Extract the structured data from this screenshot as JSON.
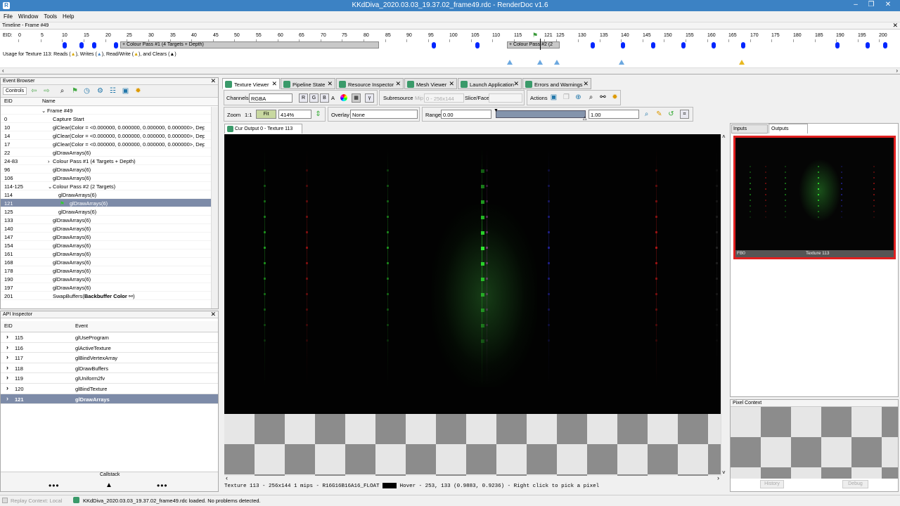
{
  "window": {
    "title": "KKdDiva_2020.03.03_19.37.02_frame49.rdc - RenderDoc v1.6",
    "app_icon": "renderdoc-icon"
  },
  "menu": [
    "File",
    "Window",
    "Tools",
    "Help"
  ],
  "timeline": {
    "title": "Timeline - Frame #49",
    "eid_label": "EID:",
    "ticks": [
      "0",
      "5",
      "10",
      "15",
      "20",
      "25",
      "30",
      "35",
      "40",
      "45",
      "50",
      "55",
      "60",
      "65",
      "70",
      "75",
      "80",
      "85",
      "90",
      "95",
      "100",
      "105",
      "110",
      "115",
      "121",
      "125",
      "130",
      "135",
      "140",
      "145",
      "150",
      "155",
      "160",
      "165",
      "170",
      "175",
      "180",
      "185",
      "190",
      "195",
      "200"
    ],
    "pass1": "+ Colour Pass #1 (4 Targets + Depth)",
    "pass2": "+ Colour Pass #2 (2",
    "usage": "Usage for Texture 113: Reads (",
    "usage_writes": "), Writes (",
    "usage_rw": "), Read/Write (",
    "usage_clears": "), and Clears (",
    "usage_end": ")"
  },
  "event_browser": {
    "title": "Event Browser",
    "controls_label": "Controls",
    "col_eid": "EID",
    "col_name": "Name",
    "rows": [
      {
        "eid": "",
        "name": "Frame #49"
      },
      {
        "eid": "0",
        "name": "Capture Start"
      },
      {
        "eid": "10",
        "name": "glClear(Color = <0.000000, 0.000000, 0.000000, 0.000000>, Dep..."
      },
      {
        "eid": "14",
        "name": "glClear(Color = <0.000000, 0.000000, 0.000000, 0.000000>, Dep..."
      },
      {
        "eid": "17",
        "name": "glClear(Color = <0.000000, 0.000000, 0.000000, 0.000000>, Dep..."
      },
      {
        "eid": "22",
        "name": "glDrawArrays(6)"
      },
      {
        "eid": "24-83",
        "name": "Colour Pass #1 (4 Targets + Depth)"
      },
      {
        "eid": "96",
        "name": "glDrawArrays(6)"
      },
      {
        "eid": "106",
        "name": "glDrawArrays(6)"
      },
      {
        "eid": "114-125",
        "name": "Colour Pass #2 (2 Targets)"
      },
      {
        "eid": "114",
        "name": "glDrawArrays(6)"
      },
      {
        "eid": "121",
        "name": "glDrawArrays(6)"
      },
      {
        "eid": "125",
        "name": "glDrawArrays(6)"
      },
      {
        "eid": "133",
        "name": "glDrawArrays(6)"
      },
      {
        "eid": "140",
        "name": "glDrawArrays(6)"
      },
      {
        "eid": "147",
        "name": "glDrawArrays(6)"
      },
      {
        "eid": "154",
        "name": "glDrawArrays(6)"
      },
      {
        "eid": "161",
        "name": "glDrawArrays(6)"
      },
      {
        "eid": "168",
        "name": "glDrawArrays(6)"
      },
      {
        "eid": "178",
        "name": "glDrawArrays(6)"
      },
      {
        "eid": "190",
        "name": "glDrawArrays(6)"
      },
      {
        "eid": "197",
        "name": "glDrawArrays(6)"
      },
      {
        "eid": "201",
        "name": "SwapBuffers(",
        "bold": "Backbuffer Color",
        "tail": ")"
      }
    ]
  },
  "api_inspector": {
    "title": "API Inspector",
    "col_eid": "EID",
    "col_event": "Event",
    "rows": [
      {
        "eid": "115",
        "name": "glUseProgram"
      },
      {
        "eid": "116",
        "name": "glActiveTexture"
      },
      {
        "eid": "117",
        "name": "glBindVertexArray"
      },
      {
        "eid": "118",
        "name": "glDrawBuffers"
      },
      {
        "eid": "119",
        "name": "glUniform2fv"
      },
      {
        "eid": "120",
        "name": "glBindTexture"
      },
      {
        "eid": "121",
        "name": "glDrawArrays"
      }
    ],
    "callstack": "Callstack"
  },
  "tabs": [
    "Texture Viewer",
    "Pipeline State",
    "Resource Inspector",
    "Mesh Viewer",
    "Launch Application",
    "Errors and Warnings"
  ],
  "toolbar": {
    "channels_label": "Channels",
    "channels_value": "RGBA",
    "r": "R",
    "g": "G",
    "b": "B",
    "a": "A",
    "subresource": "Subresource",
    "mip_label": "Mip",
    "mip_value": "0 - 256x144",
    "slice_label": "Slice/Face",
    "actions_label": "Actions",
    "zoom_label": "Zoom",
    "one_to_one": "1:1",
    "fit": "Fit",
    "zoom_value": "414%",
    "overlay_label": "Overlay",
    "overlay_value": "None",
    "range_label": "Range",
    "range_min": "0.00",
    "range_max": "1.00"
  },
  "viewer_tab": "Cur Output 0 - Texture 113",
  "status_line": {
    "info": "Texture 113 - 256x144 1 mips - R16G16B16A16_FLOAT",
    "hover": "Hover -   253,  133 (0.9883, 0.9236)  - Right click to pick a pixel"
  },
  "side_tabs": {
    "inputs": "Inputs",
    "outputs": "Outputs"
  },
  "thumbnail": {
    "left": "FB0",
    "right": "Texture 113"
  },
  "pixel_context": {
    "title": "Pixel Context",
    "history": "History",
    "debug": "Debug"
  },
  "bottom": {
    "replay": "Replay Context: Local",
    "message": "KKdDiva_2020.03.03_19.37.02_frame49.rdc loaded. No problems detected."
  },
  "colors": {
    "title_bar": "#3c82c4",
    "selection": "#7d8ba8",
    "thumb_border": "#e02020",
    "green": "#2ee82e"
  }
}
